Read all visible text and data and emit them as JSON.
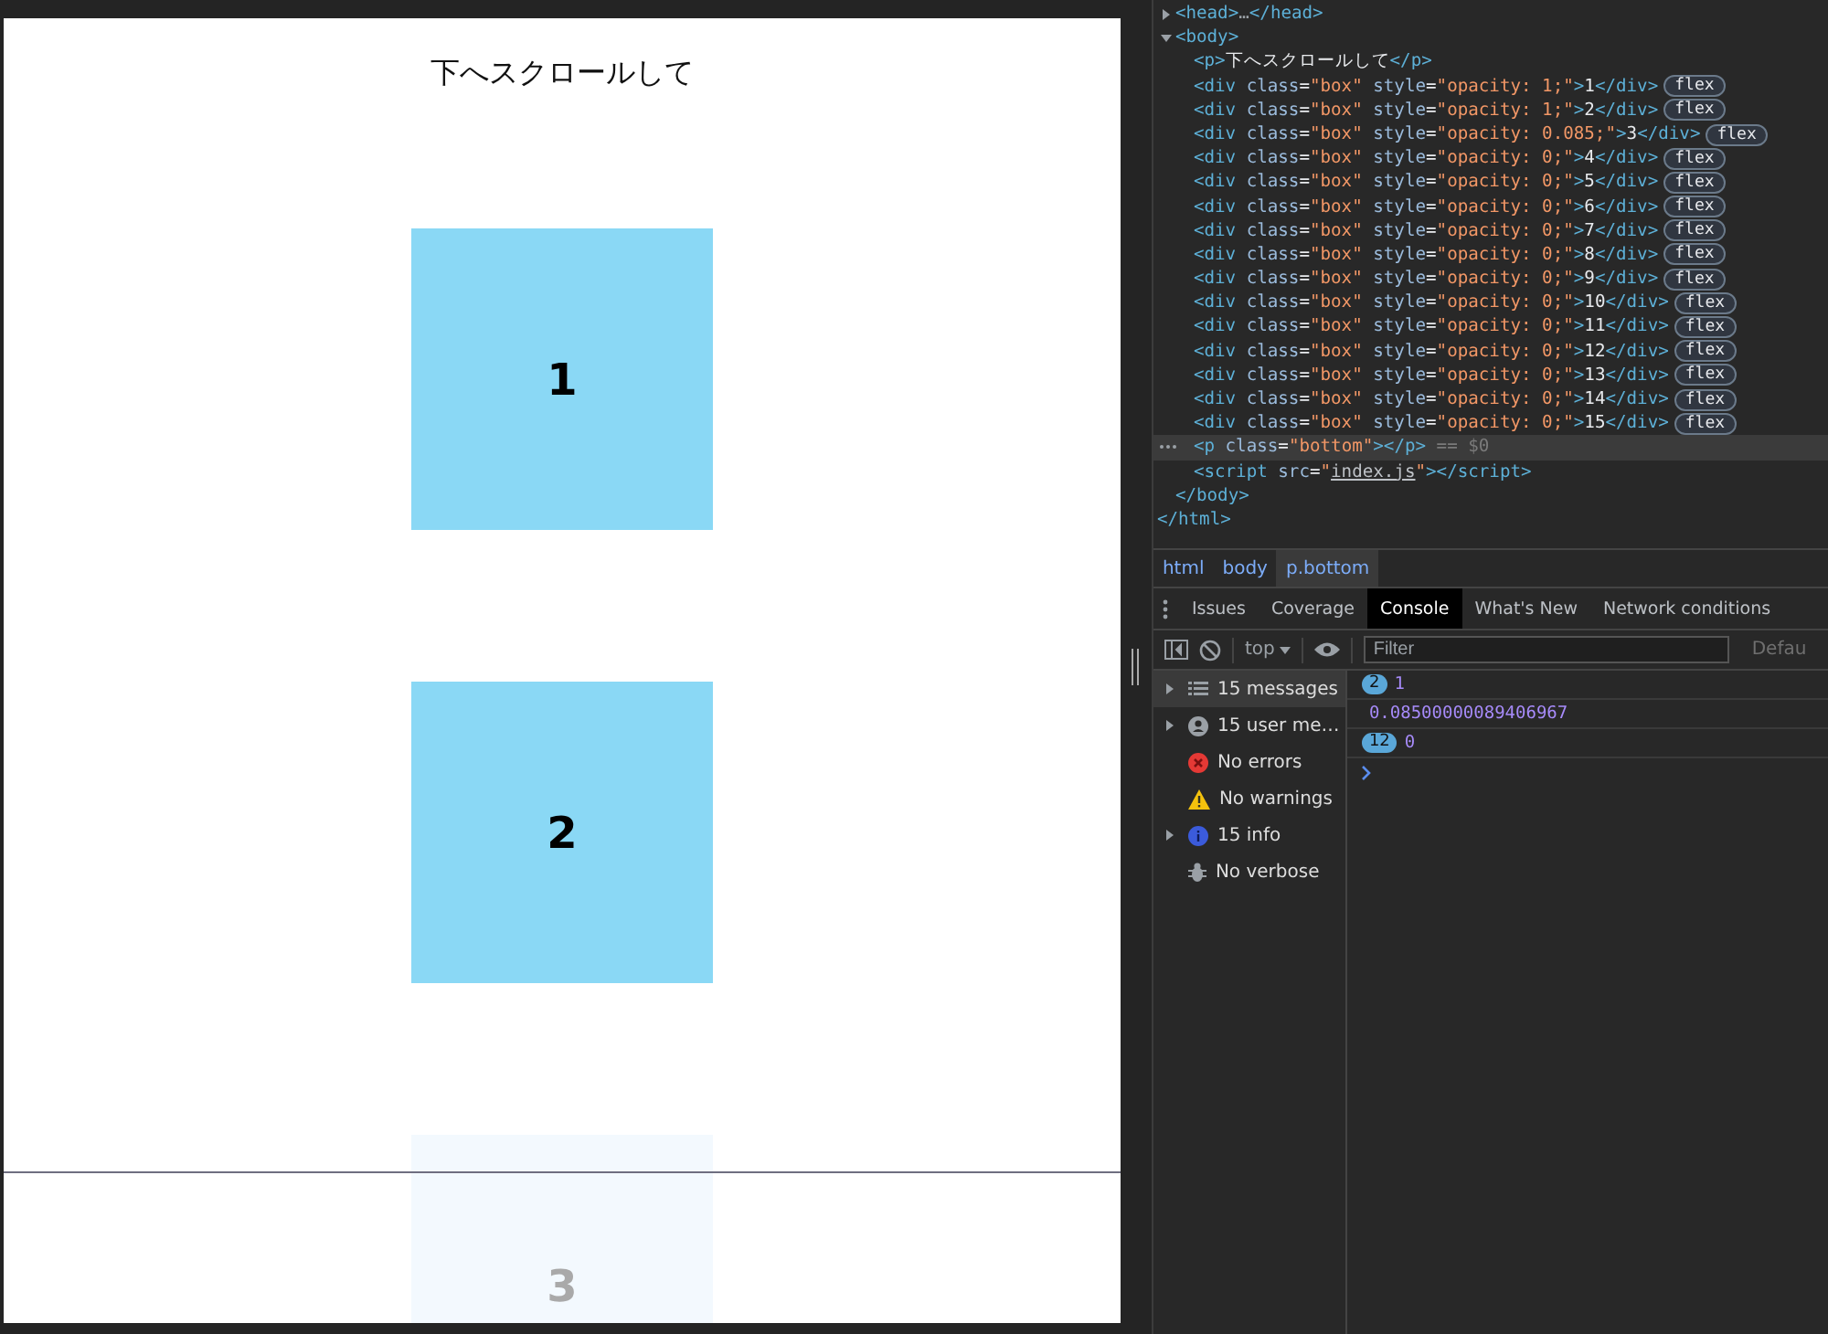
{
  "page": {
    "heading": "下へスクロールして",
    "boxes": [
      {
        "label": "1",
        "faded": false
      },
      {
        "label": "2",
        "faded": false
      },
      {
        "label": "3",
        "faded": true
      }
    ]
  },
  "devtools": {
    "tree": {
      "children": [
        {
          "tokens": [
            {
              "kind": "tag",
              "text": "<head>"
            },
            {
              "kind": "ellipsis",
              "text": "…"
            },
            {
              "kind": "tag",
              "text": "</head>"
            }
          ],
          "expanded": false,
          "selected": false
        },
        {
          "tokens": [
            {
              "kind": "tag",
              "text": "<body>"
            }
          ],
          "expanded": true,
          "selected": false,
          "children": [
            {
              "tokens": [
                {
                  "kind": "tag",
                  "text": "<p>"
                },
                {
                  "kind": "text",
                  "text": "下へスクロールして"
                },
                {
                  "kind": "tag",
                  "text": "</p>"
                }
              ],
              "selected": false
            },
            {
              "tokens": [
                {
                  "kind": "tag",
                  "text": "<div"
                },
                {
                  "kind": "attr",
                  "text": "class"
                },
                {
                  "kind": "eq",
                  "text": "="
                },
                {
                  "kind": "value",
                  "text": "\"box\""
                },
                {
                  "kind": "attr",
                  "text": "style"
                },
                {
                  "kind": "eq",
                  "text": "="
                },
                {
                  "kind": "value",
                  "text": "\"opacity: 1;\""
                },
                {
                  "kind": "tag",
                  "text": ">"
                },
                {
                  "kind": "text",
                  "text": "1"
                },
                {
                  "kind": "tag",
                  "text": "</div>"
                }
              ],
              "badge": "flex",
              "selected": false
            },
            {
              "tokens": [
                {
                  "kind": "tag",
                  "text": "<div"
                },
                {
                  "kind": "attr",
                  "text": "class"
                },
                {
                  "kind": "eq",
                  "text": "="
                },
                {
                  "kind": "value",
                  "text": "\"box\""
                },
                {
                  "kind": "attr",
                  "text": "style"
                },
                {
                  "kind": "eq",
                  "text": "="
                },
                {
                  "kind": "value",
                  "text": "\"opacity: 1;\""
                },
                {
                  "kind": "tag",
                  "text": ">"
                },
                {
                  "kind": "text",
                  "text": "2"
                },
                {
                  "kind": "tag",
                  "text": "</div>"
                }
              ],
              "badge": "flex",
              "selected": false
            },
            {
              "tokens": [
                {
                  "kind": "tag",
                  "text": "<div"
                },
                {
                  "kind": "attr",
                  "text": "class"
                },
                {
                  "kind": "eq",
                  "text": "="
                },
                {
                  "kind": "value",
                  "text": "\"box\""
                },
                {
                  "kind": "attr",
                  "text": "style"
                },
                {
                  "kind": "eq",
                  "text": "="
                },
                {
                  "kind": "value",
                  "text": "\"opacity: 0.085;\""
                },
                {
                  "kind": "tag",
                  "text": ">"
                },
                {
                  "kind": "text",
                  "text": "3"
                },
                {
                  "kind": "tag",
                  "text": "</div>"
                }
              ],
              "badge": "flex",
              "selected": false
            },
            {
              "tokens": [
                {
                  "kind": "tag",
                  "text": "<div"
                },
                {
                  "kind": "attr",
                  "text": "class"
                },
                {
                  "kind": "eq",
                  "text": "="
                },
                {
                  "kind": "value",
                  "text": "\"box\""
                },
                {
                  "kind": "attr",
                  "text": "style"
                },
                {
                  "kind": "eq",
                  "text": "="
                },
                {
                  "kind": "value",
                  "text": "\"opacity: 0;\""
                },
                {
                  "kind": "tag",
                  "text": ">"
                },
                {
                  "kind": "text",
                  "text": "4"
                },
                {
                  "kind": "tag",
                  "text": "</div>"
                }
              ],
              "badge": "flex",
              "selected": false
            },
            {
              "tokens": [
                {
                  "kind": "tag",
                  "text": "<div"
                },
                {
                  "kind": "attr",
                  "text": "class"
                },
                {
                  "kind": "eq",
                  "text": "="
                },
                {
                  "kind": "value",
                  "text": "\"box\""
                },
                {
                  "kind": "attr",
                  "text": "style"
                },
                {
                  "kind": "eq",
                  "text": "="
                },
                {
                  "kind": "value",
                  "text": "\"opacity: 0;\""
                },
                {
                  "kind": "tag",
                  "text": ">"
                },
                {
                  "kind": "text",
                  "text": "5"
                },
                {
                  "kind": "tag",
                  "text": "</div>"
                }
              ],
              "badge": "flex",
              "selected": false
            },
            {
              "tokens": [
                {
                  "kind": "tag",
                  "text": "<div"
                },
                {
                  "kind": "attr",
                  "text": "class"
                },
                {
                  "kind": "eq",
                  "text": "="
                },
                {
                  "kind": "value",
                  "text": "\"box\""
                },
                {
                  "kind": "attr",
                  "text": "style"
                },
                {
                  "kind": "eq",
                  "text": "="
                },
                {
                  "kind": "value",
                  "text": "\"opacity: 0;\""
                },
                {
                  "kind": "tag",
                  "text": ">"
                },
                {
                  "kind": "text",
                  "text": "6"
                },
                {
                  "kind": "tag",
                  "text": "</div>"
                }
              ],
              "badge": "flex",
              "selected": false
            },
            {
              "tokens": [
                {
                  "kind": "tag",
                  "text": "<div"
                },
                {
                  "kind": "attr",
                  "text": "class"
                },
                {
                  "kind": "eq",
                  "text": "="
                },
                {
                  "kind": "value",
                  "text": "\"box\""
                },
                {
                  "kind": "attr",
                  "text": "style"
                },
                {
                  "kind": "eq",
                  "text": "="
                },
                {
                  "kind": "value",
                  "text": "\"opacity: 0;\""
                },
                {
                  "kind": "tag",
                  "text": ">"
                },
                {
                  "kind": "text",
                  "text": "7"
                },
                {
                  "kind": "tag",
                  "text": "</div>"
                }
              ],
              "badge": "flex",
              "selected": false
            },
            {
              "tokens": [
                {
                  "kind": "tag",
                  "text": "<div"
                },
                {
                  "kind": "attr",
                  "text": "class"
                },
                {
                  "kind": "eq",
                  "text": "="
                },
                {
                  "kind": "value",
                  "text": "\"box\""
                },
                {
                  "kind": "attr",
                  "text": "style"
                },
                {
                  "kind": "eq",
                  "text": "="
                },
                {
                  "kind": "value",
                  "text": "\"opacity: 0;\""
                },
                {
                  "kind": "tag",
                  "text": ">"
                },
                {
                  "kind": "text",
                  "text": "8"
                },
                {
                  "kind": "tag",
                  "text": "</div>"
                }
              ],
              "badge": "flex",
              "selected": false
            },
            {
              "tokens": [
                {
                  "kind": "tag",
                  "text": "<div"
                },
                {
                  "kind": "attr",
                  "text": "class"
                },
                {
                  "kind": "eq",
                  "text": "="
                },
                {
                  "kind": "value",
                  "text": "\"box\""
                },
                {
                  "kind": "attr",
                  "text": "style"
                },
                {
                  "kind": "eq",
                  "text": "="
                },
                {
                  "kind": "value",
                  "text": "\"opacity: 0;\""
                },
                {
                  "kind": "tag",
                  "text": ">"
                },
                {
                  "kind": "text",
                  "text": "9"
                },
                {
                  "kind": "tag",
                  "text": "</div>"
                }
              ],
              "badge": "flex",
              "selected": false
            },
            {
              "tokens": [
                {
                  "kind": "tag",
                  "text": "<div"
                },
                {
                  "kind": "attr",
                  "text": "class"
                },
                {
                  "kind": "eq",
                  "text": "="
                },
                {
                  "kind": "value",
                  "text": "\"box\""
                },
                {
                  "kind": "attr",
                  "text": "style"
                },
                {
                  "kind": "eq",
                  "text": "="
                },
                {
                  "kind": "value",
                  "text": "\"opacity: 0;\""
                },
                {
                  "kind": "tag",
                  "text": ">"
                },
                {
                  "kind": "text",
                  "text": "10"
                },
                {
                  "kind": "tag",
                  "text": "</div>"
                }
              ],
              "badge": "flex",
              "selected": false
            },
            {
              "tokens": [
                {
                  "kind": "tag",
                  "text": "<div"
                },
                {
                  "kind": "attr",
                  "text": "class"
                },
                {
                  "kind": "eq",
                  "text": "="
                },
                {
                  "kind": "value",
                  "text": "\"box\""
                },
                {
                  "kind": "attr",
                  "text": "style"
                },
                {
                  "kind": "eq",
                  "text": "="
                },
                {
                  "kind": "value",
                  "text": "\"opacity: 0;\""
                },
                {
                  "kind": "tag",
                  "text": ">"
                },
                {
                  "kind": "text",
                  "text": "11"
                },
                {
                  "kind": "tag",
                  "text": "</div>"
                }
              ],
              "badge": "flex",
              "selected": false
            },
            {
              "tokens": [
                {
                  "kind": "tag",
                  "text": "<div"
                },
                {
                  "kind": "attr",
                  "text": "class"
                },
                {
                  "kind": "eq",
                  "text": "="
                },
                {
                  "kind": "value",
                  "text": "\"box\""
                },
                {
                  "kind": "attr",
                  "text": "style"
                },
                {
                  "kind": "eq",
                  "text": "="
                },
                {
                  "kind": "value",
                  "text": "\"opacity: 0;\""
                },
                {
                  "kind": "tag",
                  "text": ">"
                },
                {
                  "kind": "text",
                  "text": "12"
                },
                {
                  "kind": "tag",
                  "text": "</div>"
                }
              ],
              "badge": "flex",
              "selected": false
            },
            {
              "tokens": [
                {
                  "kind": "tag",
                  "text": "<div"
                },
                {
                  "kind": "attr",
                  "text": "class"
                },
                {
                  "kind": "eq",
                  "text": "="
                },
                {
                  "kind": "value",
                  "text": "\"box\""
                },
                {
                  "kind": "attr",
                  "text": "style"
                },
                {
                  "kind": "eq",
                  "text": "="
                },
                {
                  "kind": "value",
                  "text": "\"opacity: 0;\""
                },
                {
                  "kind": "tag",
                  "text": ">"
                },
                {
                  "kind": "text",
                  "text": "13"
                },
                {
                  "kind": "tag",
                  "text": "</div>"
                }
              ],
              "badge": "flex",
              "selected": false
            },
            {
              "tokens": [
                {
                  "kind": "tag",
                  "text": "<div"
                },
                {
                  "kind": "attr",
                  "text": "class"
                },
                {
                  "kind": "eq",
                  "text": "="
                },
                {
                  "kind": "value",
                  "text": "\"box\""
                },
                {
                  "kind": "attr",
                  "text": "style"
                },
                {
                  "kind": "eq",
                  "text": "="
                },
                {
                  "kind": "value",
                  "text": "\"opacity: 0;\""
                },
                {
                  "kind": "tag",
                  "text": ">"
                },
                {
                  "kind": "text",
                  "text": "14"
                },
                {
                  "kind": "tag",
                  "text": "</div>"
                }
              ],
              "badge": "flex",
              "selected": false
            },
            {
              "tokens": [
                {
                  "kind": "tag",
                  "text": "<div"
                },
                {
                  "kind": "attr",
                  "text": "class"
                },
                {
                  "kind": "eq",
                  "text": "="
                },
                {
                  "kind": "value",
                  "text": "\"box\""
                },
                {
                  "kind": "attr",
                  "text": "style"
                },
                {
                  "kind": "eq",
                  "text": "="
                },
                {
                  "kind": "value",
                  "text": "\"opacity: 0;\""
                },
                {
                  "kind": "tag",
                  "text": ">"
                },
                {
                  "kind": "text",
                  "text": "15"
                },
                {
                  "kind": "tag",
                  "text": "</div>"
                }
              ],
              "badge": "flex",
              "selected": false
            },
            {
              "tokens": [
                {
                  "kind": "tag",
                  "text": "<p"
                },
                {
                  "kind": "attr",
                  "text": "class"
                },
                {
                  "kind": "eq",
                  "text": "="
                },
                {
                  "kind": "value",
                  "text": "\"bottom\""
                },
                {
                  "kind": "tag",
                  "text": "></p>"
                },
                {
                  "kind": "marker",
                  "text": "== $0"
                }
              ],
              "selected": true
            },
            {
              "tokens": [
                {
                  "kind": "tag",
                  "text": "<script"
                },
                {
                  "kind": "attr",
                  "text": "src"
                },
                {
                  "kind": "eq",
                  "text": "="
                },
                {
                  "kind": "value",
                  "text": "\""
                },
                {
                  "kind": "link",
                  "text": "index.js"
                },
                {
                  "kind": "value",
                  "text": "\""
                },
                {
                  "kind": "tag",
                  "text": "></script>"
                }
              ],
              "selected": false
            }
          ],
          "closing": [
            {
              "kind": "tag",
              "text": "</body>"
            }
          ]
        }
      ],
      "closing": [
        {
          "kind": "tag",
          "text": "</html>"
        }
      ]
    },
    "breadcrumbs": [
      {
        "label": "html",
        "selected": false
      },
      {
        "label": "body",
        "selected": false
      },
      {
        "label": "p.bottom",
        "selected": true
      }
    ],
    "drawer_tabs": [
      {
        "label": "Issues",
        "selected": false
      },
      {
        "label": "Coverage",
        "selected": false
      },
      {
        "label": "Console",
        "selected": true
      },
      {
        "label": "What's New",
        "selected": false
      },
      {
        "label": "Network conditions",
        "selected": false
      }
    ],
    "toolbar": {
      "context": "top",
      "filter_placeholder": "Filter",
      "levels": "Defau"
    },
    "sidebar": [
      {
        "kind": "messages",
        "label": "15 messages",
        "expanded": false,
        "selected": true
      },
      {
        "kind": "user",
        "label": "15 user me…",
        "expanded": false,
        "selected": false
      },
      {
        "kind": "error",
        "label": "No errors",
        "selected": false
      },
      {
        "kind": "warning",
        "label": "No warnings",
        "selected": false
      },
      {
        "kind": "info",
        "label": "15 info",
        "expanded": false,
        "selected": false
      },
      {
        "kind": "verbose",
        "label": "No verbose",
        "selected": false
      }
    ],
    "messages": [
      {
        "count": "2",
        "text": "1"
      },
      {
        "text": "0.08500000089406967"
      },
      {
        "count": "12",
        "text": "0"
      }
    ]
  }
}
